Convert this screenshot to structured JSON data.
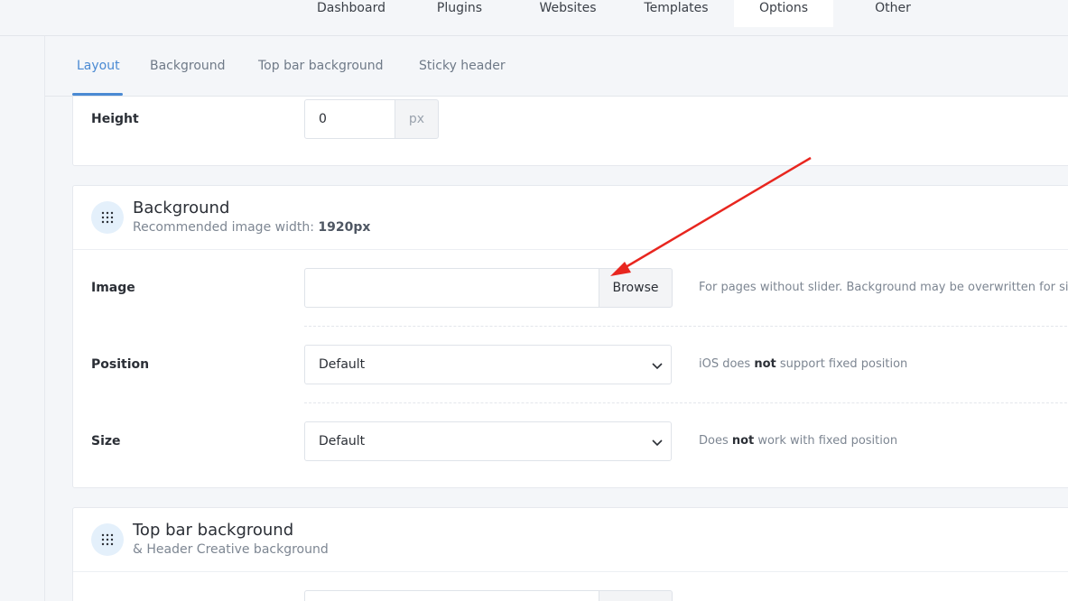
{
  "nav": {
    "items": [
      {
        "label": "Dashboard"
      },
      {
        "label": "Plugins"
      },
      {
        "label": "Websites"
      },
      {
        "label": "Templates"
      },
      {
        "label": "Options",
        "active": true
      },
      {
        "label": "Other"
      }
    ]
  },
  "subtabs": [
    {
      "label": "Layout",
      "active": true
    },
    {
      "label": "Background"
    },
    {
      "label": "Top bar background"
    },
    {
      "label": "Sticky header"
    }
  ],
  "height_field": {
    "label": "Height",
    "value": "0",
    "unit": "px"
  },
  "background_section": {
    "title": "Background",
    "subtitle_prefix": "Recommended image width: ",
    "subtitle_bold": "1920px",
    "image": {
      "label": "Image",
      "value": "",
      "browse_label": "Browse",
      "help": "For pages without slider. Background may be overwritten for sir"
    },
    "position": {
      "label": "Position",
      "selected": "Default",
      "help_prefix": "iOS does ",
      "help_bold": "not",
      "help_suffix": " support fixed position"
    },
    "size": {
      "label": "Size",
      "selected": "Default",
      "help_prefix": "Does ",
      "help_bold": "not",
      "help_suffix": " work with fixed position"
    }
  },
  "top_bar_section": {
    "title": "Top bar background",
    "subtitle": "& Header Creative background"
  },
  "colors": {
    "accent": "#4a8ad3",
    "annotation_arrow": "#e8261f"
  },
  "icons": {
    "section_icon": "grid-dots-icon",
    "chevron": "chevron-down-icon"
  }
}
